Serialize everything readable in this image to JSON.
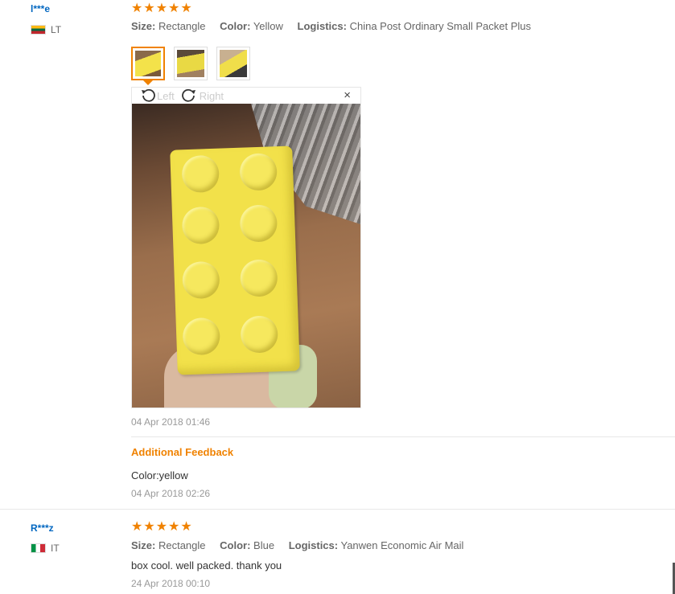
{
  "reviews": [
    {
      "user": "l***e",
      "country": "LT",
      "rating": 5,
      "attributes": {
        "size_label": "Size:",
        "size_value": "Rectangle",
        "color_label": "Color:",
        "color_value": "Yellow",
        "logistics_label": "Logistics:",
        "logistics_value": "China Post Ordinary Small Packet Plus"
      },
      "viewer": {
        "rotate_left": "Left",
        "rotate_right": "Right",
        "close": "×"
      },
      "date": "04 Apr 2018 01:46",
      "additional_feedback": {
        "title": "Additional Feedback",
        "text": "Color:yellow",
        "date": "04 Apr 2018 02:26"
      }
    },
    {
      "user": "R***z",
      "country": "IT",
      "rating": 5,
      "attributes": {
        "size_label": "Size:",
        "size_value": "Rectangle",
        "color_label": "Color:",
        "color_value": "Blue",
        "logistics_label": "Logistics:",
        "logistics_value": "Yanwen Economic Air Mail"
      },
      "text": "box cool. well packed. thank you",
      "date": "24 Apr 2018 00:10"
    }
  ],
  "colors": {
    "accent": "#f08200",
    "username": "#0066c0",
    "muted": "#999999"
  },
  "icons": {
    "star": "star-icon",
    "rotate_left": "rotate-left-icon",
    "rotate_right": "rotate-right-icon",
    "close": "close-icon"
  }
}
